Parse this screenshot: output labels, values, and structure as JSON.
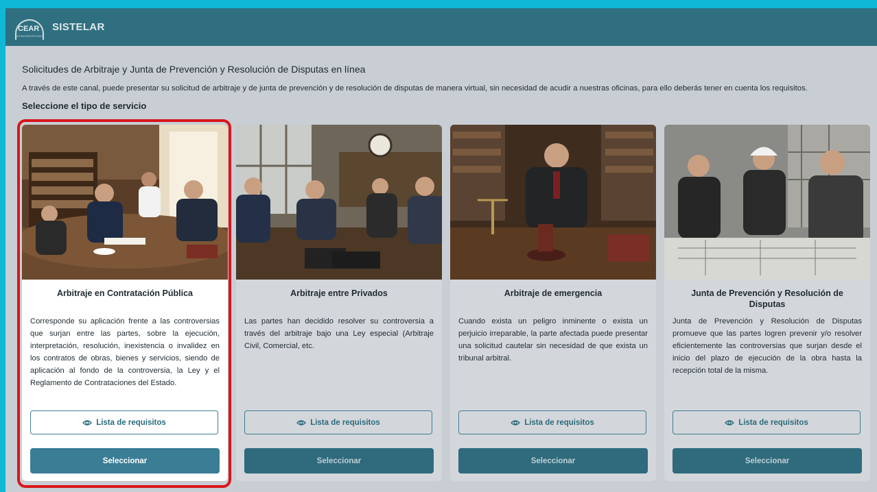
{
  "app": {
    "logo_text": "CEAR",
    "logo_sub": "LATINOAMERICANO",
    "title": "SISTELAR"
  },
  "page": {
    "heading": "Solicitudes de Arbitraje y Junta de Prevención y Resolución de Disputas en línea",
    "description": "A través de este canal, puede presentar su solicitud de arbitraje y de junta de prevención y de resolución de disputas de manera virtual, sin necesidad de acudir a nuestras oficinas, para ello deberás tener en cuenta los requisitos.",
    "select_label": "Seleccione el tipo de servicio"
  },
  "cards": [
    {
      "title": "Arbitraje en Contratación Pública",
      "body": "Corresponde su aplicación frente a las controversias que surjan entre las partes, sobre la ejecución, interpretación, resolución, inexistencia o invalidez en los contratos de obras, bienes y servicios, siendo de aplicación al fondo de la controversia, la Ley y el Reglamento de Contrataciones del Estado.",
      "requirements_label": "Lista de requisitos",
      "select_label": "Seleccionar"
    },
    {
      "title": "Arbitraje entre Privados",
      "body": "Las partes han decidido resolver su controversia a través del arbitraje bajo una Ley especial (Arbitraje Civil, Comercial, etc.",
      "requirements_label": "Lista de requisitos",
      "select_label": "Seleccionar"
    },
    {
      "title": "Arbitraje de emergencia",
      "body": "Cuando exista un peligro inminente o exista un perjuicio irreparable, la parte afectada puede presentar una solicitud cautelar sin necesidad de que exista un tribunal arbitral.",
      "requirements_label": "Lista de requisitos",
      "select_label": "Seleccionar"
    },
    {
      "title": "Junta de Prevención y Resolución de Disputas",
      "body": "Junta de Prevención y Resolución de Disputas promueve que las partes logren prevenir y/o resolver eficientemente las controversias que surjan desde el inicio del plazo de ejecución de la obra hasta la recepción total de la misma.",
      "requirements_label": "Lista de requisitos",
      "select_label": "Seleccionar"
    }
  ],
  "colors": {
    "accent": "#2f6f80",
    "highlight": "#d8161c",
    "page_bg": "#0fb8d6"
  }
}
